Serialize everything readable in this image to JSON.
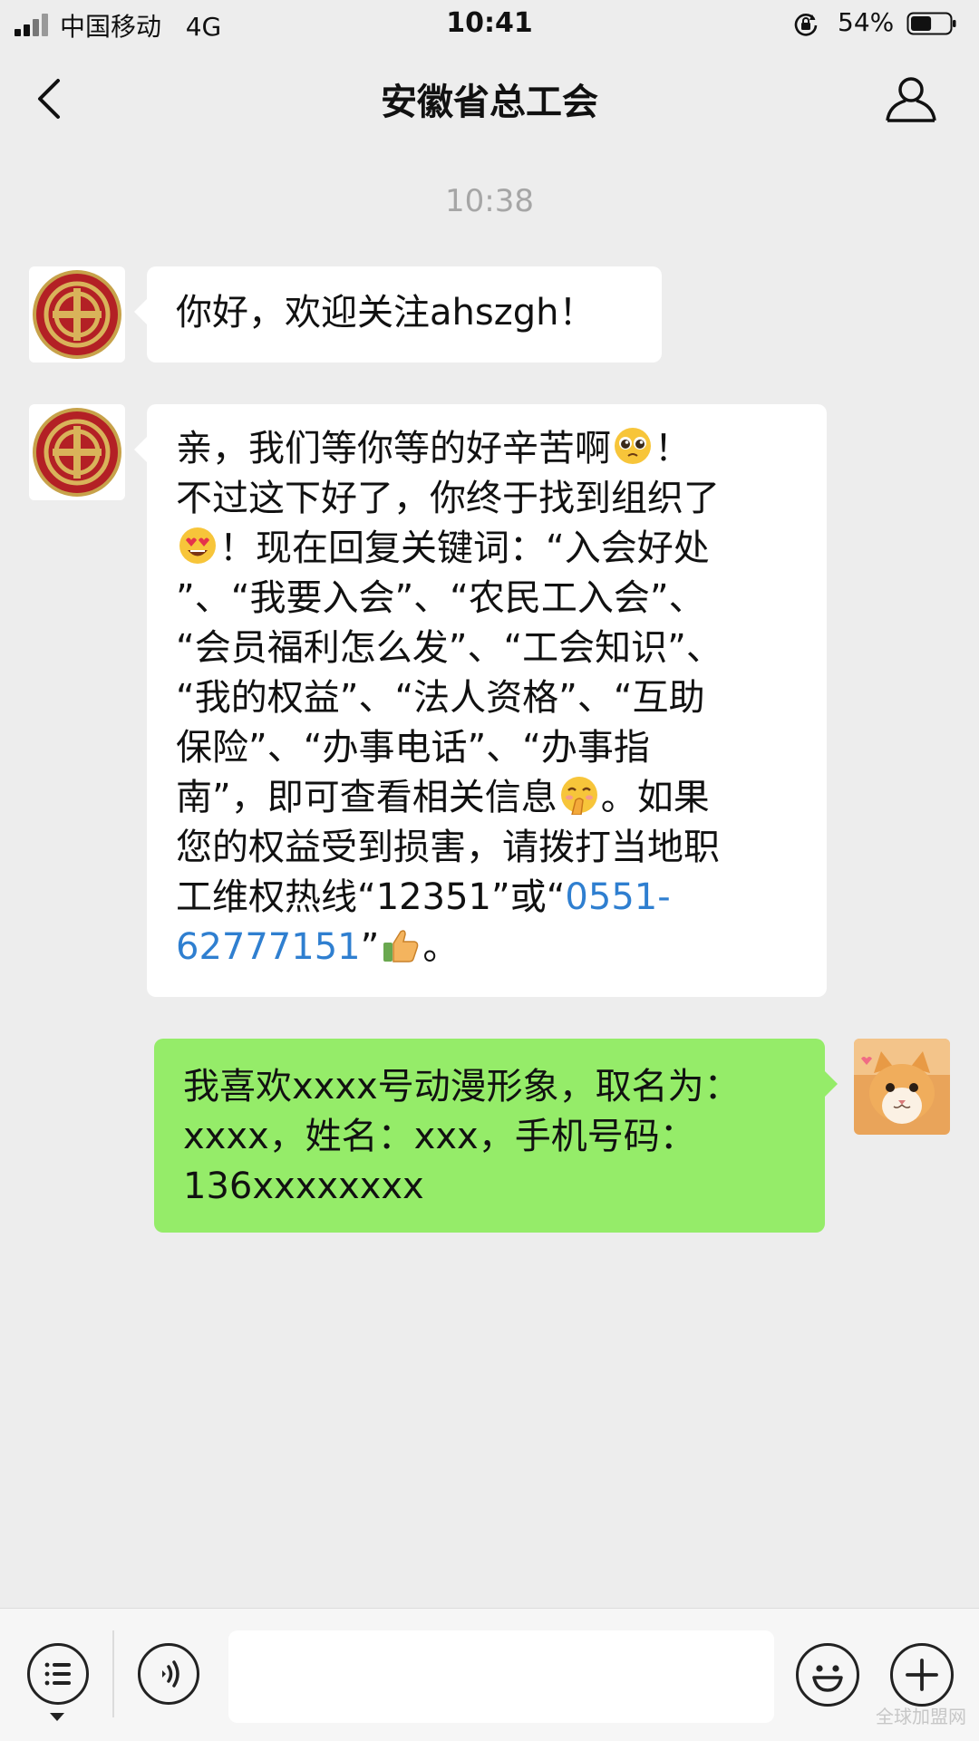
{
  "status_bar": {
    "carrier": "中国移动",
    "network": "4G",
    "time": "10:41",
    "battery_percent": "54%",
    "battery_level": 0.54
  },
  "nav": {
    "title": "安徽省总工会",
    "back_icon": "chevron-left-icon",
    "profile_icon": "person-icon"
  },
  "chat": {
    "timestamp": "10:38",
    "messages": [
      {
        "sender": "official",
        "lines": [
          "你好，欢迎关注ahszgh！"
        ]
      },
      {
        "sender": "official",
        "lines": [
          "亲，我们等你等的好辛苦啊",
          "！",
          "不过这下好了，你终于找到组织了",
          "！现在回复关键词：“入会好处",
          "”、“我要入会”、“农民工入会”、",
          "“会员福利怎么发”、“工会知识”、",
          "“我的权益”、“法人资格”、“互助",
          "保险”、“办事电话”、“办事指",
          "南”，即可查看相关信息",
          "。如果",
          "您的权益受到损害，请拨打当地职",
          "工维权热线“12351”或“",
          "0551-",
          "62777151",
          "”",
          "。"
        ]
      },
      {
        "sender": "me",
        "lines": [
          "我喜欢xxxx号动漫形象，取名为：",
          "xxxx，姓名：xxx，手机号码：",
          "136xxxxxxxx"
        ]
      }
    ]
  },
  "input_bar": {
    "menu_icon": "list-menu-icon",
    "voice_icon": "voice-icon",
    "emoji_icon": "smiley-icon",
    "add_icon": "plus-icon",
    "text_value": ""
  },
  "watermark": "全球加盟网",
  "colors": {
    "background": "#ededed",
    "sent_bubble": "#95ec69",
    "link": "#2f7fd0"
  }
}
